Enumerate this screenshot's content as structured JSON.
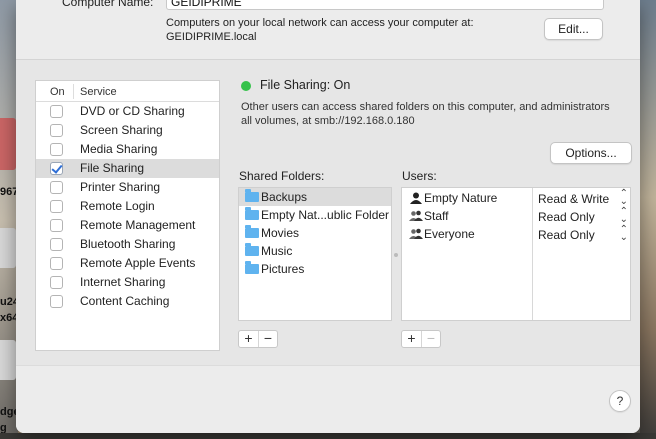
{
  "computer_name": {
    "label": "Computer Name:",
    "value": "GEIDIPRIME",
    "description_line1": "Computers on your local network can access your computer at:",
    "description_line2": "GEIDIPRIME.local",
    "edit_button": "Edit..."
  },
  "service_list": {
    "header_on": "On",
    "header_service": "Service",
    "items": [
      {
        "label": "DVD or CD Sharing",
        "checked": false
      },
      {
        "label": "Screen Sharing",
        "checked": false
      },
      {
        "label": "Media Sharing",
        "checked": false
      },
      {
        "label": "File Sharing",
        "checked": true,
        "selected": true
      },
      {
        "label": "Printer Sharing",
        "checked": false
      },
      {
        "label": "Remote Login",
        "checked": false
      },
      {
        "label": "Remote Management",
        "checked": false
      },
      {
        "label": "Bluetooth Sharing",
        "checked": false
      },
      {
        "label": "Remote Apple Events",
        "checked": false
      },
      {
        "label": "Internet Sharing",
        "checked": false
      },
      {
        "label": "Content Caching",
        "checked": false
      }
    ]
  },
  "status": {
    "title": "File Sharing: On",
    "color": "#35c24a",
    "description_line1": "Other users can access shared folders on this computer, and administrators",
    "description_line2": "all volumes, at smb://192.168.0.180"
  },
  "options_button": "Options...",
  "shared_folders": {
    "label": "Shared Folders:",
    "items": [
      "Backups",
      "Empty Nat...ublic Folder",
      "Movies",
      "Music",
      "Pictures"
    ]
  },
  "users": {
    "label": "Users:",
    "items": [
      {
        "name": "Empty Nature",
        "icon": "single-user-icon",
        "permission": "Read & Write"
      },
      {
        "name": "Staff",
        "icon": "group-icon",
        "permission": "Read Only"
      },
      {
        "name": "Everyone",
        "icon": "group-icon",
        "permission": "Read Only"
      }
    ]
  },
  "controls": {
    "plus": "+",
    "minus": "−",
    "help": "?",
    "chevron": "⌃⌄"
  },
  "desktop_fragments": [
    "967",
    "u24",
    "x64",
    "dge",
    "g"
  ]
}
